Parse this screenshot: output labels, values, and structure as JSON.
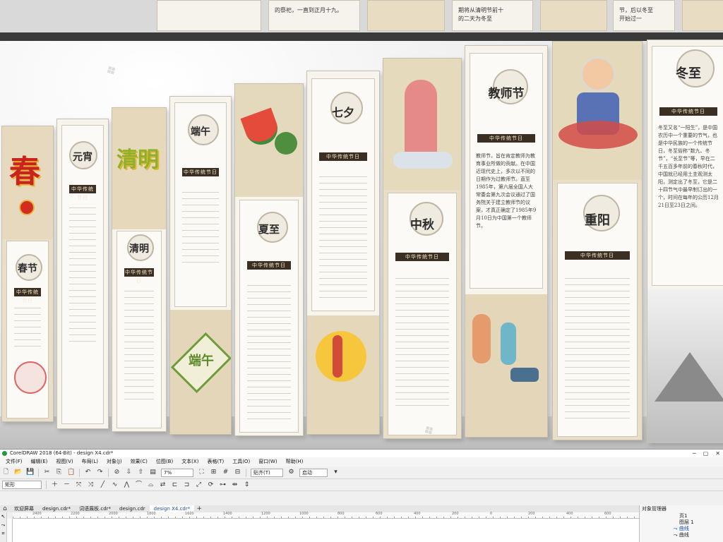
{
  "top_band": {
    "text1": "的祭祀，一直到正月十九。",
    "text2": "期将从清明节前十",
    "text3": "节，后以冬至",
    "text4": "的二天为冬至",
    "text5": "开始过一"
  },
  "panels": {
    "p1": {
      "title": "春节",
      "bar": "中华传统节日"
    },
    "p2": {
      "title": "元宵",
      "bar": "中华传统节日"
    },
    "p3": {
      "title": "清明",
      "bar": "中华传统节日"
    },
    "p4": {
      "title": "端午",
      "bar": "中华传统节日"
    },
    "p5": {
      "title": "夏至",
      "bar": "中华传统节日"
    },
    "p6": {
      "title": "七夕",
      "bar": "中华传统节日"
    },
    "p7": {
      "title": "中秋",
      "bar": "中华传统节日"
    },
    "p8": {
      "title": "教师节",
      "bar": "中华传统节日"
    },
    "p9": {
      "title": "重阳",
      "bar": "中华传统节日"
    },
    "p10": {
      "title": "冬至",
      "bar": "中华传统节日"
    }
  },
  "panel_text": {
    "qingming_art": "清明",
    "spring_art": "春",
    "duanwu_art": "端午",
    "dongzhi_body": "冬至又名“一阳生”，是中国农历中一个重要的节气，也是中华民族的一个传统节日，冬至俗称“数九、冬节”，“长至节”等，早在二千五百多年前的春秋时代，中国就已经用土圭观测太阳，测定出了冬至，它是二十四节气中最早制订出的一个，时间在每年的公历12月21日至23日之间。",
    "teacher_body": "教师节，旨在肯定教师为教育事业所做的贡献。在中国近现代史上，多次以不同的日期作为过教师节。直至1985年，第六届全国人大常委会第九次会议通过了国务院关于建立教师节的议案，才真正确定了1985年9月10日为中国第一个教师节。"
  },
  "app": {
    "title": "CorelDRAW 2018 (64-Bit) - design X4.cdr*",
    "menus": [
      "文件(F)",
      "编辑(E)",
      "视图(V)",
      "布局(L)",
      "对象(J)",
      "效果(C)",
      "位图(B)",
      "文本(X)",
      "表格(T)",
      "工具(O)",
      "窗口(W)",
      "帮助(H)"
    ],
    "zoom": "7%",
    "snap_label": "贴齐(T)",
    "start_label": "启动",
    "shape_tool": "矩形",
    "tabs": [
      "欢迎屏幕",
      "design.cdr*",
      "词语展板.cdr*",
      "design.cdr",
      "design X4.cdr*"
    ],
    "ruler": [
      "2400",
      "2200",
      "2000",
      "1800",
      "1600",
      "1400",
      "1200",
      "1000",
      "800",
      "600",
      "400",
      "200",
      "0",
      "200",
      "400",
      "600"
    ],
    "dock_title": "对象管理器",
    "tree": [
      "页1",
      "图层 1",
      "曲线",
      "曲线"
    ]
  }
}
